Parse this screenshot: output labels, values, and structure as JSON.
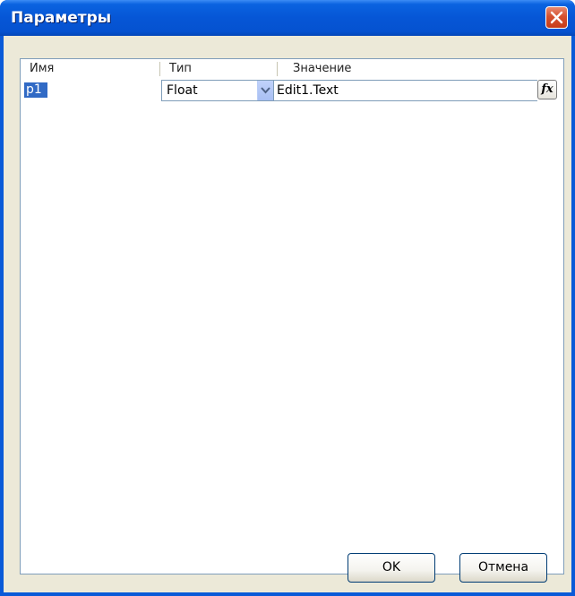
{
  "window": {
    "title": "Параметры"
  },
  "grid": {
    "columns": [
      "Имя",
      "Тип",
      "Значение"
    ],
    "rows": [
      {
        "name": "p1",
        "type": "Float",
        "value": "Edit1.Text",
        "fx_label": "fx"
      }
    ]
  },
  "buttons": {
    "ok": "OK",
    "cancel": "Отмена"
  },
  "icons": {
    "close": "close-icon",
    "dropdown": "chevron-down-icon"
  },
  "colors": {
    "titlebar": "#0a5ad8",
    "selection": "#316ac5",
    "close_button": "#d5512f",
    "dialog_bg": "#ece9d8"
  }
}
